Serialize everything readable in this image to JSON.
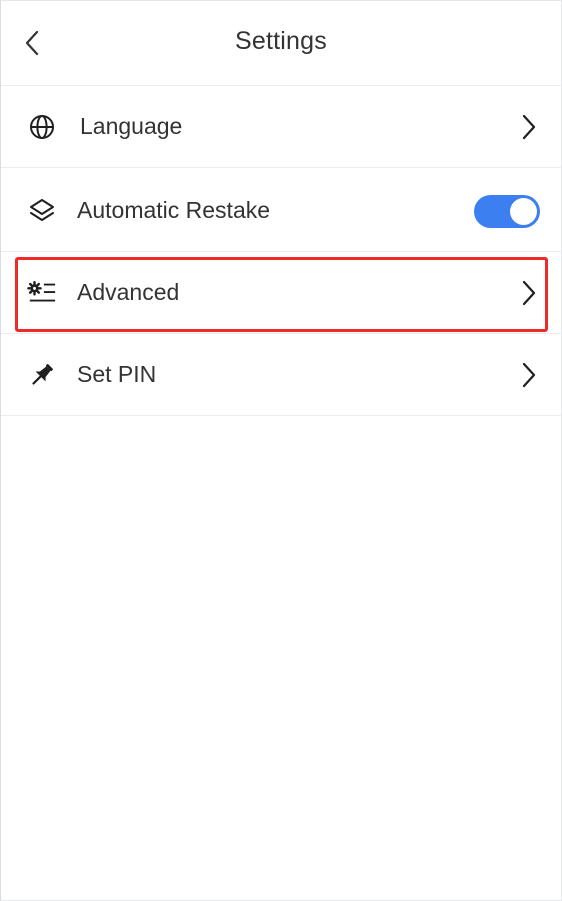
{
  "header": {
    "title": "Settings",
    "back_icon": "chevron-left-icon"
  },
  "settings": {
    "items": [
      {
        "label": "Language",
        "icon": "globe-icon",
        "control": "chevron"
      },
      {
        "label": "Automatic Restake",
        "icon": "layers-icon",
        "control": "toggle",
        "toggle_on": true
      },
      {
        "label": "Advanced",
        "icon": "advanced-settings-icon",
        "control": "chevron",
        "highlighted": true
      },
      {
        "label": "Set PIN",
        "icon": "pin-icon",
        "control": "chevron"
      }
    ]
  },
  "colors": {
    "toggle_on": "#3b7ff0",
    "highlight_border": "#ee2a2a",
    "text": "#333333",
    "divider": "#ececec"
  }
}
